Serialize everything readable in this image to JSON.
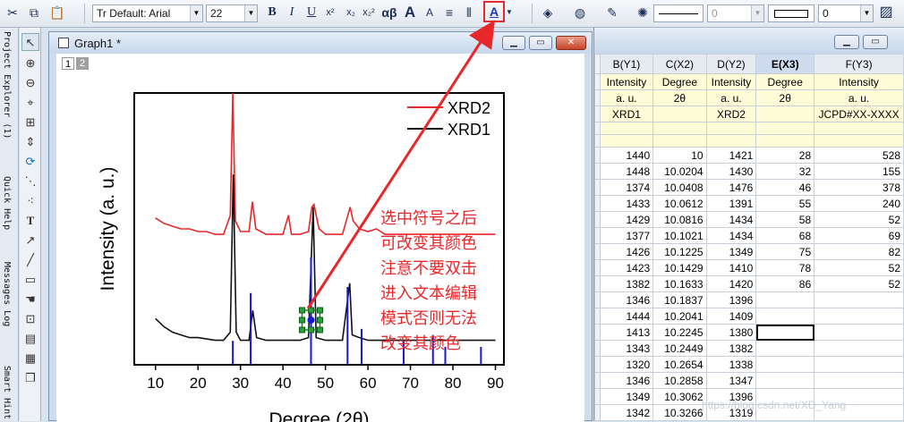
{
  "toolbar": {
    "font_name": "Tr Default: Arial",
    "font_size": "22",
    "bold": "B",
    "italic": "I",
    "underline": "U",
    "superscript": "x²",
    "subscript": "x₂",
    "greek": "αβ",
    "increase_font": "A",
    "decrease_font": "A",
    "line_width_value": "0",
    "fill_value": "0"
  },
  "left_panels": {
    "project_explorer": "Project Explorer (1)",
    "quick_help": "Quick Help",
    "messages_log": "Messages Log",
    "smart_hint": "Smart Hint"
  },
  "graph_window": {
    "title": "Graph1 *",
    "layers": [
      "1",
      "2"
    ]
  },
  "chart_data": {
    "type": "line",
    "xlabel": "Degree (2θ)",
    "ylabel": "Intensity (a. u.)",
    "xlim": [
      5,
      92
    ],
    "x_ticks": [
      10,
      20,
      30,
      40,
      50,
      60,
      70,
      80,
      90
    ],
    "legend_position": "top-right",
    "series": [
      {
        "name": "XRD2",
        "color": "#e8272b",
        "x": [
          10,
          12,
          14,
          16,
          18,
          20,
          22,
          24,
          26,
          27.6,
          28.2,
          28.8,
          30,
          32,
          32.8,
          33.6,
          36,
          40,
          41.3,
          42,
          44,
          46,
          46.8,
          47.3,
          47.8,
          48.5,
          50,
          52,
          54,
          55.8,
          56.5,
          58,
          60,
          62,
          64,
          66,
          68,
          70,
          72,
          74,
          76,
          78,
          80,
          82,
          84,
          86,
          88,
          90
        ],
        "y": [
          0.54,
          0.52,
          0.51,
          0.5,
          0.5,
          0.49,
          0.49,
          0.48,
          0.48,
          0.55,
          1.0,
          0.53,
          0.49,
          0.49,
          0.6,
          0.5,
          0.48,
          0.48,
          0.55,
          0.48,
          0.48,
          0.49,
          0.58,
          0.59,
          0.55,
          0.5,
          0.48,
          0.48,
          0.48,
          0.58,
          0.53,
          0.5,
          0.49,
          0.5,
          0.48,
          0.48,
          0.48,
          0.48,
          0.48,
          0.48,
          0.48,
          0.48,
          0.48,
          0.48,
          0.48,
          0.48,
          0.48,
          0.48
        ]
      },
      {
        "name": "XRD1",
        "color": "#111111",
        "x": [
          10,
          12,
          14,
          16,
          18,
          20,
          22,
          24,
          26,
          27.6,
          28.3,
          29,
          30,
          32,
          32.9,
          33.8,
          36,
          40,
          44,
          46,
          47.1,
          47.8,
          50,
          52,
          54,
          55.7,
          56.3,
          58,
          60,
          62,
          64,
          66,
          68,
          70,
          72,
          74,
          76,
          78,
          80,
          82,
          84,
          86,
          88,
          90
        ],
        "y": [
          0.17,
          0.14,
          0.12,
          0.11,
          0.1,
          0.1,
          0.095,
          0.09,
          0.09,
          0.12,
          0.7,
          0.12,
          0.09,
          0.09,
          0.2,
          0.1,
          0.09,
          0.09,
          0.09,
          0.1,
          0.58,
          0.1,
          0.09,
          0.09,
          0.09,
          0.3,
          0.11,
          0.1,
          0.09,
          0.09,
          0.09,
          0.09,
          0.09,
          0.09,
          0.09,
          0.09,
          0.09,
          0.09,
          0.09,
          0.09,
          0.09,
          0.09,
          0.09,
          0.09
        ]
      },
      {
        "name": "JCPD",
        "color": "#1717d6",
        "type": "sticks",
        "x": [
          28.2,
          32.4,
          46.6,
          55.2,
          58.5,
          68.4,
          75.3,
          78.2,
          86.6
        ],
        "y": [
          0.04,
          0.12,
          0.18,
          0.13,
          0.06,
          0.04,
          0.05,
          0.03,
          0.03
        ]
      }
    ]
  },
  "annotation": {
    "lines": [
      "选中符号之后",
      "可改变其颜色",
      "注意不要双击",
      "进入文本编辑",
      "模式否则无法",
      "改变其颜色"
    ],
    "color": "#e8272b"
  },
  "worksheet": {
    "columns": [
      {
        "header": "B(Y1)",
        "long_name": "Intensity",
        "units": "a. u.",
        "comment": "XRD1"
      },
      {
        "header": "C(X2)",
        "long_name": "Degree",
        "units": "2θ",
        "comment": ""
      },
      {
        "header": "D(Y2)",
        "long_name": "Intensity",
        "units": "a. u.",
        "comment": "XRD2"
      },
      {
        "header": "E(X3)",
        "long_name": "Degree",
        "units": "2θ",
        "comment": ""
      },
      {
        "header": "F(Y3)",
        "long_name": "Intensity",
        "units": "a. u.",
        "comment": "JCPD#XX-XXXX"
      }
    ],
    "rows": [
      [
        "1440",
        "10",
        "1421",
        "28",
        "528"
      ],
      [
        "1448",
        "10.0204",
        "1430",
        "32",
        "155"
      ],
      [
        "1374",
        "10.0408",
        "1476",
        "46",
        "378"
      ],
      [
        "1433",
        "10.0612",
        "1391",
        "55",
        "240"
      ],
      [
        "1429",
        "10.0816",
        "1434",
        "58",
        "52"
      ],
      [
        "1377",
        "10.1021",
        "1434",
        "68",
        "69"
      ],
      [
        "1426",
        "10.1225",
        "1349",
        "75",
        "82"
      ],
      [
        "1423",
        "10.1429",
        "1410",
        "78",
        "52"
      ],
      [
        "1382",
        "10.1633",
        "1420",
        "86",
        "52"
      ],
      [
        "1346",
        "10.1837",
        "1396",
        "",
        ""
      ],
      [
        "1444",
        "10.2041",
        "1409",
        "",
        ""
      ],
      [
        "1413",
        "10.2245",
        "1380",
        "",
        ""
      ],
      [
        "1343",
        "10.2449",
        "1382",
        "",
        ""
      ],
      [
        "1320",
        "10.2654",
        "1338",
        "",
        ""
      ],
      [
        "1346",
        "10.2858",
        "1347",
        "",
        ""
      ],
      [
        "1349",
        "10.3062",
        "1396",
        "",
        ""
      ],
      [
        "1342",
        "10.3266",
        "1319",
        "",
        ""
      ]
    ]
  },
  "watermark": "https://blog.csdn.net/XD_Yang"
}
